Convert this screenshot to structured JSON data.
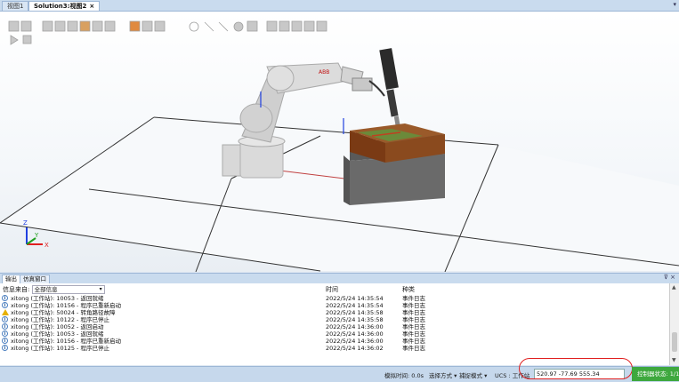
{
  "tabs": [
    {
      "label": "视图1",
      "active": false
    },
    {
      "label": "Solution3:视图2",
      "active": true
    }
  ],
  "tab_close": "×",
  "tab_menu": "▾",
  "viewport": {
    "axis_labels": {
      "x": "X",
      "y": "Y",
      "z": "Z"
    },
    "robot_brand": "ABB",
    "colors": {
      "robot": "#dcdcdc",
      "table_top": "#8a4a1e",
      "table_body": "#6d6d6d",
      "pad": "#6b8a3a",
      "floor_line": "#333333",
      "axis_x": "#e02020",
      "axis_y": "#20a020",
      "axis_z": "#2040e0"
    }
  },
  "output": {
    "tabs": [
      {
        "label": "输出"
      },
      {
        "label": "仿真窗口"
      }
    ],
    "pin": "⊽ ×",
    "filter_label": "信息来自:",
    "filter_value": "全部信息",
    "col_time": "时间",
    "col_category": "种类",
    "rows": [
      {
        "icon": "info-icon",
        "message": "xitong (工作站): 10053 - 返回就绪",
        "time": "2022/5/24 14:35:54",
        "category": "事件日志"
      },
      {
        "icon": "info-icon",
        "message": "xitong (工作站): 10156 - 程序已重新启动",
        "time": "2022/5/24 14:35:54",
        "category": "事件日志"
      },
      {
        "icon": "warning-icon",
        "message": "xitong (工作站): 50024 - 转角路径故障",
        "time": "2022/5/24 14:35:58",
        "category": "事件日志"
      },
      {
        "icon": "info-icon",
        "message": "xitong (工作站): 10122 - 程序已停止",
        "time": "2022/5/24 14:35:58",
        "category": "事件日志"
      },
      {
        "icon": "info-icon",
        "message": "xitong (工作站): 10052 - 返回启动",
        "time": "2022/5/24 14:36:00",
        "category": "事件日志"
      },
      {
        "icon": "info-icon",
        "message": "xitong (工作站): 10053 - 返回就绪",
        "time": "2022/5/24 14:36:00",
        "category": "事件日志"
      },
      {
        "icon": "info-icon",
        "message": "xitong (工作站): 10156 - 程序已重新启动",
        "time": "2022/5/24 14:36:00",
        "category": "事件日志"
      },
      {
        "icon": "info-icon",
        "message": "xitong (工作站): 10125 - 程序已停止",
        "time": "2022/5/24 14:36:02",
        "category": "事件日志"
      }
    ]
  },
  "statusbar": {
    "sim_time": "模拟时间: 0.0s",
    "select_mode": "选择方式 ▾",
    "snap_mode": "捕捉模式 ▾",
    "ucs": "UCS : 工作站",
    "coords": "520.97  -77.69  555.34",
    "controller_status": "控制器状态:",
    "controller_count": "1/1",
    "highlight_color": "#e02020",
    "status_color": "#3ea83e"
  }
}
